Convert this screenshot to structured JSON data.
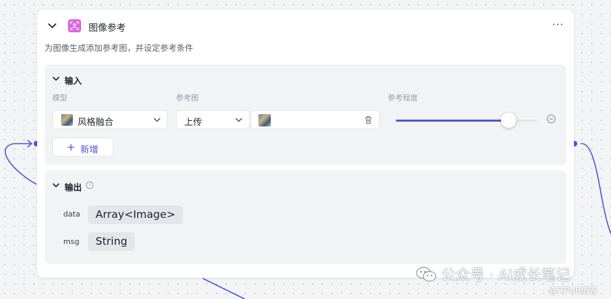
{
  "node": {
    "title": "图像参考",
    "description": "为图像生成添加参考图，并设定参考条件",
    "more_label": "···",
    "icon": "image-frame-icon",
    "icon_color": "#de63de"
  },
  "input_section": {
    "title": "输入",
    "columns": {
      "model": "模型",
      "ref_image": "参考图",
      "strength": "参考程度"
    },
    "model_select": {
      "value": "风格融合",
      "thumbnail": "style-thumbnail-icon"
    },
    "upload_select": {
      "value": "上传"
    },
    "image_upload": {
      "thumbnail": "uploaded-image-thumbnail",
      "delete_icon": "trash-icon"
    },
    "strength_slider": {
      "value": 0.8
    },
    "add_button": {
      "plus": "+",
      "label": "新增"
    }
  },
  "output_section": {
    "title": "输出",
    "info_icon": "i",
    "rows": [
      {
        "name": "data",
        "type": "Array<Image>"
      },
      {
        "name": "msg",
        "type": "String"
      }
    ]
  },
  "watermark": {
    "text": "公众号 · AI成长笔记",
    "sub": "@ITPUB博客",
    "icon": "wechat-icon"
  },
  "colors": {
    "accent": "#4e55d6",
    "panel": "#f2f3f5",
    "card": "#ffffff"
  }
}
